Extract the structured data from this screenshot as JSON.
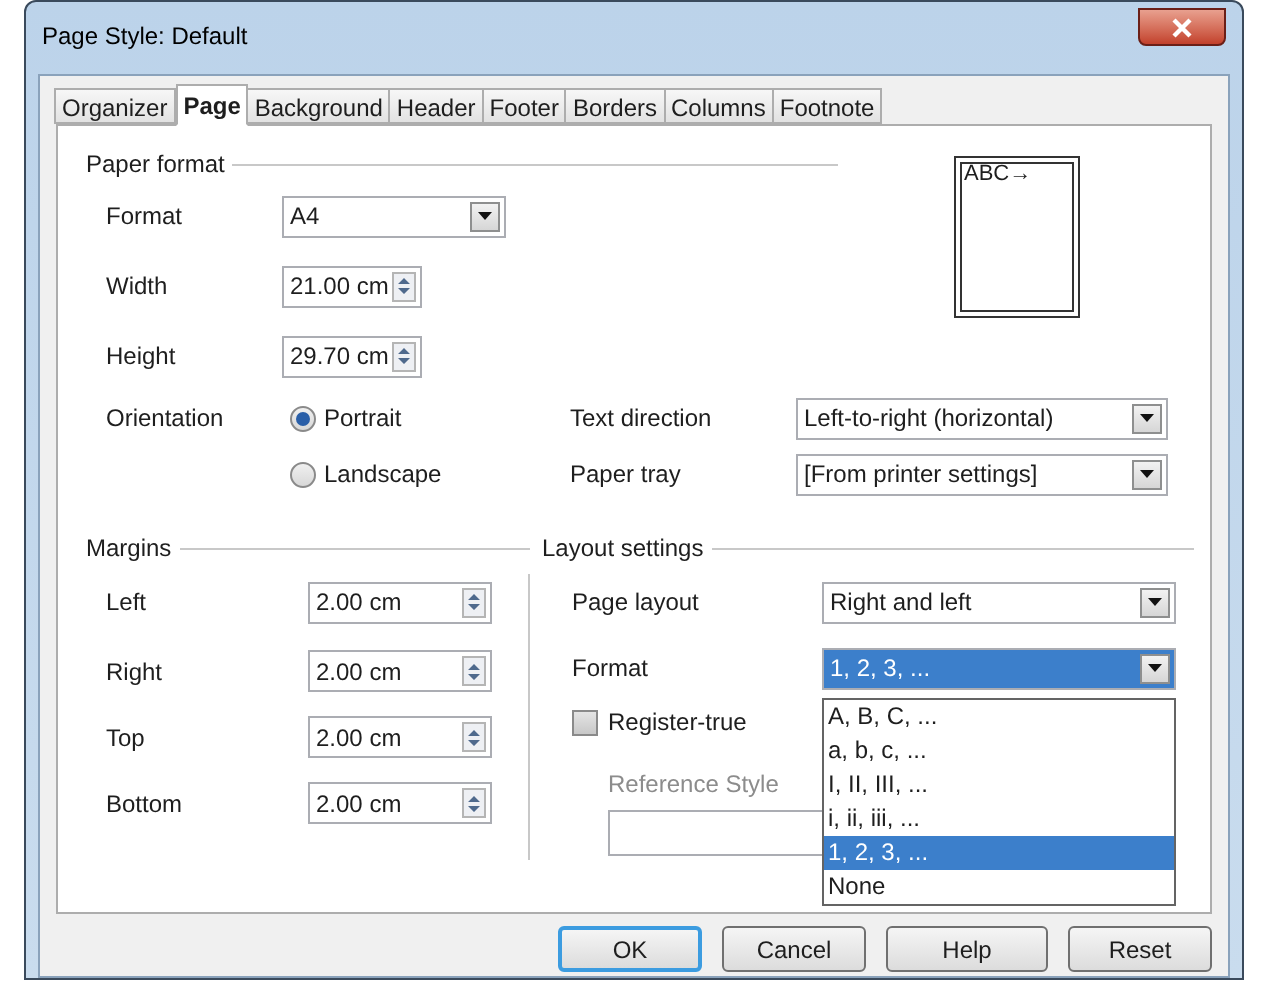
{
  "window": {
    "title": "Page Style: Default"
  },
  "tabs": [
    {
      "label": "Organizer",
      "selected": false
    },
    {
      "label": "Page",
      "selected": true
    },
    {
      "label": "Background",
      "selected": false
    },
    {
      "label": "Header",
      "selected": false
    },
    {
      "label": "Footer",
      "selected": false
    },
    {
      "label": "Borders",
      "selected": false
    },
    {
      "label": "Columns",
      "selected": false
    },
    {
      "label": "Footnote",
      "selected": false
    }
  ],
  "paper_format": {
    "title": "Paper format",
    "format": {
      "label": "Format",
      "value": "A4"
    },
    "width": {
      "label": "Width",
      "value": "21.00 cm"
    },
    "height": {
      "label": "Height",
      "value": "29.70 cm"
    },
    "orientation": {
      "label": "Orientation",
      "options": [
        {
          "label": "Portrait",
          "selected": true
        },
        {
          "label": "Landscape",
          "selected": false
        }
      ]
    },
    "text_direction": {
      "label": "Text direction",
      "value": "Left-to-right (horizontal)"
    },
    "paper_tray": {
      "label": "Paper tray",
      "value": "[From printer settings]"
    },
    "preview_text": "ABC→"
  },
  "margins": {
    "title": "Margins",
    "fields": [
      {
        "label": "Left",
        "value": "2.00 cm"
      },
      {
        "label": "Right",
        "value": "2.00 cm"
      },
      {
        "label": "Top",
        "value": "2.00 cm"
      },
      {
        "label": "Bottom",
        "value": "2.00 cm"
      }
    ]
  },
  "layout_settings": {
    "title": "Layout settings",
    "page_layout": {
      "label": "Page layout",
      "value": "Right and left"
    },
    "format": {
      "label": "Format",
      "value": "1, 2, 3, ...",
      "expanded": true,
      "options": [
        {
          "label": "A, B, C, ...",
          "selected": false
        },
        {
          "label": "a, b, c, ...",
          "selected": false
        },
        {
          "label": "I, II, III, ...",
          "selected": false
        },
        {
          "label": "i, ii, iii, ...",
          "selected": false
        },
        {
          "label": "1, 2, 3, ...",
          "selected": true
        },
        {
          "label": "None",
          "selected": false
        }
      ]
    },
    "register_true": {
      "label": "Register-true",
      "checked": false
    },
    "reference_style": {
      "label": "Reference Style",
      "disabled": true
    }
  },
  "buttons": [
    {
      "label": "OK",
      "default": true
    },
    {
      "label": "Cancel",
      "default": false
    },
    {
      "label": "Help",
      "default": false
    },
    {
      "label": "Reset",
      "default": false
    }
  ]
}
